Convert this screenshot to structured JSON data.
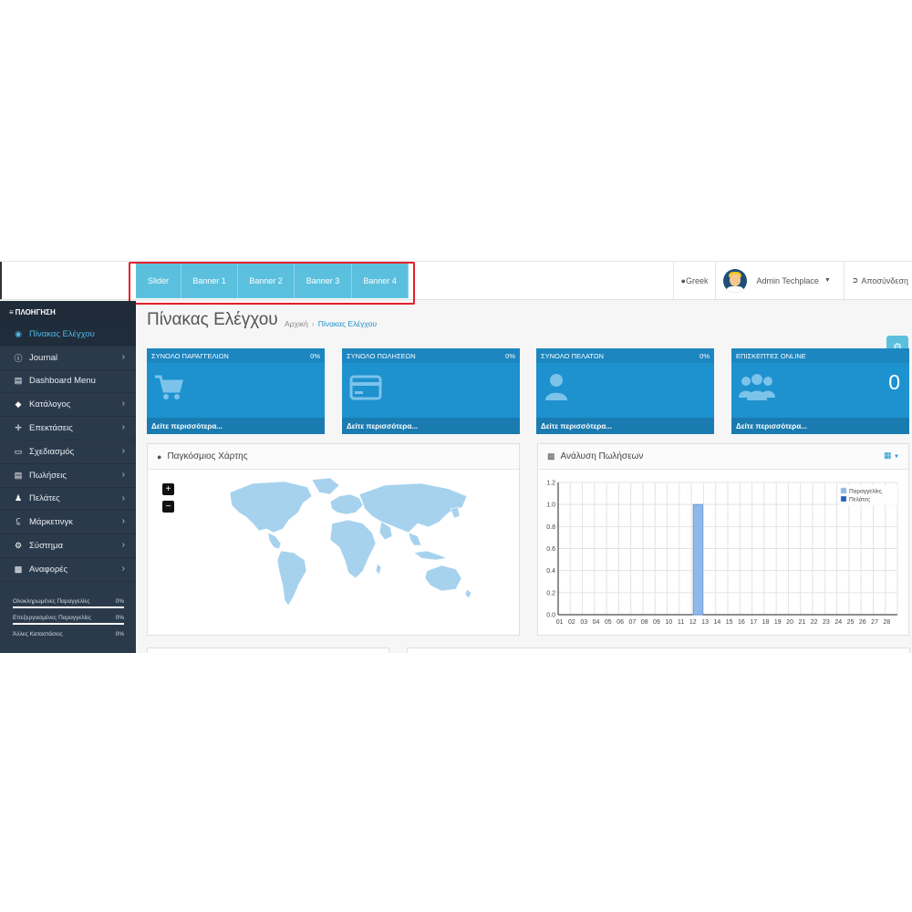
{
  "header": {
    "banner_tabs": [
      {
        "label": "Slider"
      },
      {
        "label": "Banner 1"
      },
      {
        "label": "Banner 2"
      },
      {
        "label": "Banner 3"
      },
      {
        "label": "Banner 4"
      }
    ],
    "language": "Greek",
    "user": "Admin Techplace",
    "logout": "Αποσύνδεση"
  },
  "sidebar": {
    "title": "ΠΛΟΗΓΗΣΗ",
    "items": [
      {
        "label": "Πίνακας Ελέγχου",
        "icon": "dashboard-icon",
        "active": true
      },
      {
        "label": "Journal",
        "icon": "journal-icon",
        "chevron": true
      },
      {
        "label": "Dashboard Menu",
        "icon": "menu-card-icon"
      },
      {
        "label": "Κατάλογος",
        "icon": "tag-icon",
        "chevron": true
      },
      {
        "label": "Επεκτάσεις",
        "icon": "puzzle-icon",
        "chevron": true
      },
      {
        "label": "Σχεδιασμός",
        "icon": "monitor-icon",
        "chevron": true
      },
      {
        "label": "Πωλήσεις",
        "icon": "cart-icon",
        "chevron": true
      },
      {
        "label": "Πελάτες",
        "icon": "user-icon",
        "chevron": true
      },
      {
        "label": "Μάρκετινγκ",
        "icon": "share-icon",
        "chevron": true
      },
      {
        "label": "Σύστημα",
        "icon": "cog-icon",
        "chevron": true
      },
      {
        "label": "Αναφορές",
        "icon": "bar-chart-icon",
        "chevron": true
      }
    ],
    "progress": [
      {
        "label": "Ολοκληρωμένες Παραγγελίες",
        "value": "0%"
      },
      {
        "label": "Επεξεργασμένες Παραγγελίες",
        "value": "0%"
      },
      {
        "label": "Άλλες Καταστάσεις",
        "value": "0%"
      }
    ]
  },
  "page": {
    "title": "Πίνακας Ελέγχου",
    "breadcrumb_home": "Αρχική",
    "breadcrumb_current": "Πίνακας Ελέγχου"
  },
  "tiles": [
    {
      "title": "ΣΥΝΟΛΟ ΠΑΡΑΓΓΕΛΙΩΝ",
      "percent": "0%",
      "footer": "Δείτε περισσότερα...",
      "icon": "cart-icon"
    },
    {
      "title": "ΣΥΝΟΛΟ ΠΩΛΗΣΕΩΝ",
      "percent": "0%",
      "footer": "Δείτε περισσότερα...",
      "icon": "credit-card-icon"
    },
    {
      "title": "ΣΥΝΟΛΟ ΠΕΛΑΤΩΝ",
      "percent": "0%",
      "footer": "Δείτε περισσότερα...",
      "icon": "user-icon"
    },
    {
      "title": "ΕΠΙΣΚΕΠΤΕΣ ONLINE",
      "value": "0",
      "footer": "Δείτε περισσότερα...",
      "icon": "users-icon"
    }
  ],
  "map_panel": {
    "title": "Παγκόσμιος Χάρτης",
    "zoom_in": "+",
    "zoom_out": "−"
  },
  "sales_panel": {
    "title": "Ανάλυση Πωλήσεων"
  },
  "colors": {
    "accent": "#1e91cf",
    "tab": "#5bc0de",
    "sidebar": "#2b3a4b",
    "map_land": "#a6d2ee",
    "orders_bar": "#8fb8ea",
    "customers": "#1f5fbf"
  },
  "chart_data": {
    "type": "bar",
    "categories": [
      "01",
      "02",
      "03",
      "04",
      "05",
      "06",
      "07",
      "08",
      "09",
      "10",
      "11",
      "12",
      "13",
      "14",
      "15",
      "16",
      "17",
      "18",
      "19",
      "20",
      "21",
      "22",
      "23",
      "24",
      "25",
      "26",
      "27",
      "28"
    ],
    "series": [
      {
        "name": "Παραγγελίες",
        "values": [
          0,
          0,
          0,
          0,
          0,
          0,
          0,
          0,
          0,
          0,
          0,
          1,
          0,
          0,
          0,
          0,
          0,
          0,
          0,
          0,
          0,
          0,
          0,
          0,
          0,
          0,
          0,
          0
        ]
      },
      {
        "name": "Πελάτες",
        "values": [
          0,
          0,
          0,
          0,
          0,
          0,
          0,
          0,
          0,
          0,
          0,
          0,
          0,
          0,
          0,
          0,
          0,
          0,
          0,
          0,
          0,
          0,
          0,
          0,
          0,
          0,
          0,
          0
        ]
      }
    ],
    "ylim": [
      0,
      1.2
    ],
    "yticks": [
      "0.0",
      "0.2",
      "0.4",
      "0.6",
      "0.8",
      "1.0",
      "1.2"
    ],
    "grid": true,
    "legend_position": "top-right"
  }
}
